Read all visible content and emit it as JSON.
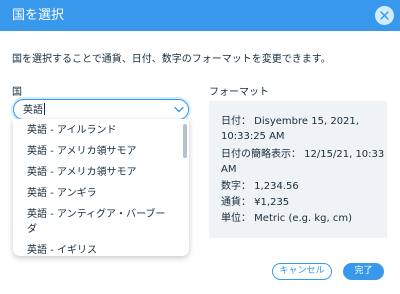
{
  "dialog": {
    "title": "国を選択",
    "description": "国を選択することで通貨、日付、数字のフォーマットを変更できます。"
  },
  "country": {
    "label": "国",
    "value": "英語",
    "options": [
      "英語 - アイルランド",
      "英語 - アメリカ領サモア",
      "英語 - アメリカ領サモア",
      "英語 - アンギラ",
      "英語 - アンティグア・バーブー",
      "ダ",
      "英語 - イギリス"
    ]
  },
  "format": {
    "label": "フォーマット",
    "lines": [
      "日付： Disyembre 15, 2021,",
      "10:33:25 AM",
      "日付の簡略表示： 12/15/21, 10:33",
      "AM",
      "数字： 1,234.56",
      "通貨： ¥1,235",
      "単位： Metric (e.g. kg, cm)"
    ]
  },
  "buttons": {
    "cancel": "キャンセル",
    "ok": "完了"
  },
  "icons": {
    "close": "close-icon",
    "chevron": "chevron-down-icon"
  },
  "colors": {
    "accent": "#3899ec",
    "format_bg": "#eff3f5",
    "text": "#162d3d"
  }
}
